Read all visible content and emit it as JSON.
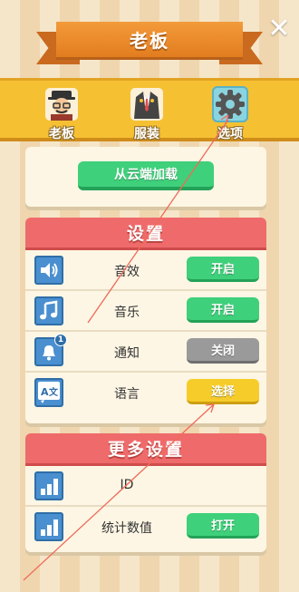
{
  "header": {
    "title": "老板",
    "close_icon": "close-icon"
  },
  "tabs": [
    {
      "label": "老板",
      "icon": "businessman-avatar-icon",
      "selected": false
    },
    {
      "label": "服装",
      "icon": "suit-icon",
      "selected": false
    },
    {
      "label": "选项",
      "icon": "gear-icon",
      "selected": true
    }
  ],
  "cloud": {
    "button_label": "从云端加载"
  },
  "settings": {
    "title": "设置",
    "rows": [
      {
        "icon": "speaker-icon",
        "label": "音效",
        "button": "开启",
        "button_color": "#3ed07a"
      },
      {
        "icon": "music-note-icon",
        "label": "音乐",
        "button": "开启",
        "button_color": "#3ed07a"
      },
      {
        "icon": "bell-icon",
        "label": "通知",
        "button": "关闭",
        "button_color": "#9a9a9a",
        "badge": "1"
      },
      {
        "icon": "translate-icon",
        "label": "语言",
        "button": "选择",
        "button_color": "#f6cc2a"
      }
    ]
  },
  "more": {
    "title": "更多设置",
    "rows": [
      {
        "icon": "bar-chart-icon",
        "label": "ID"
      },
      {
        "icon": "bar-chart-icon",
        "label": "统计数值",
        "button": "打开",
        "button_color": "#3ed07a"
      }
    ]
  },
  "colors": {
    "ribbon": "#f39a3a",
    "tabbar": "#f5c133",
    "header_red": "#ef6b6b",
    "icon_blue": "#4a8fd0",
    "annotation_line": "#f06a5a"
  }
}
